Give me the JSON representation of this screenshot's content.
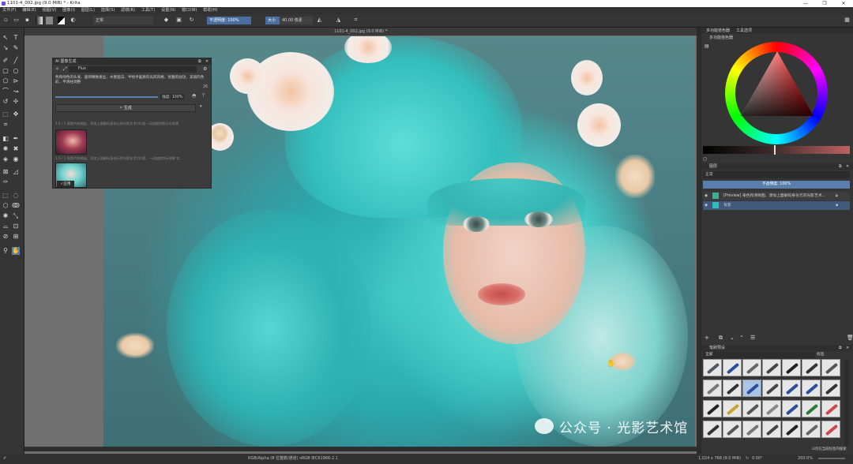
{
  "window": {
    "title": "1101-4_002.jpg (9.0 MiB) * - Krita",
    "controls": [
      "—",
      "❐",
      "✕"
    ]
  },
  "menu": [
    "文件(F)",
    "编辑(E)",
    "视图(V)",
    "图像(I)",
    "图层(L)",
    "选择(S)",
    "滤镜(R)",
    "工具(T)",
    "设置(N)",
    "窗口(W)",
    "帮助(H)"
  ],
  "toolbar": {
    "blend_mode": "正常",
    "opacity": "不透明度: 100%",
    "size_label": "大小",
    "size_value": "40.00 像素"
  },
  "document_tab": "1101-4_002.jpg (9.0 MiB) *",
  "ai_panel": {
    "title": "AI 图像生成",
    "model": "Flux",
    "prompt": "色和绿色的头发、画师精致发丝、水墨画法、半绘手画质的光风风格、优雅的幼功、美丽的色彩、平滑柱调整",
    "token_count": "26",
    "strength": "强度: 100%",
    "generate_button": "生成",
    "history_text_1": "1.5 / 1 张图片的输出、添加上面解码身份元的光影艺术(学)程一动加提供图示实效果",
    "history_text_2": "1.5 / 1 张图片的输出、添加上面解码身份元的光影艺术(学)程、一动加提供示效果 实",
    "apply_button": "应用"
  },
  "dock": {
    "color_tabs": [
      "多功能拾色器",
      "工具选项"
    ],
    "color_panel_title": "多功能拾色器",
    "layers_title": "图层",
    "layers_blend": "正常",
    "layers_opacity": "不透明度: 100%",
    "layers": [
      {
        "name": "[Preview] 染色和清晰图、添加上面解码身份元的光影艺术..."
      },
      {
        "name": "背景"
      }
    ],
    "brushes_title": "笔刷预设",
    "brushes_filter": "全部",
    "brushes_tag": "标签",
    "brushes_footer": "仅在当前标签内搜索"
  },
  "status": {
    "color_mode": "RGB/Alpha (8 位整数/通道)  sRGB IEC61966-2.1",
    "dimensions": "1,024 x 768 (9.0 MiB)",
    "rotation": "0.00°",
    "zoom": "200.0%"
  },
  "watermark": "公众号 · 光影艺术馆"
}
